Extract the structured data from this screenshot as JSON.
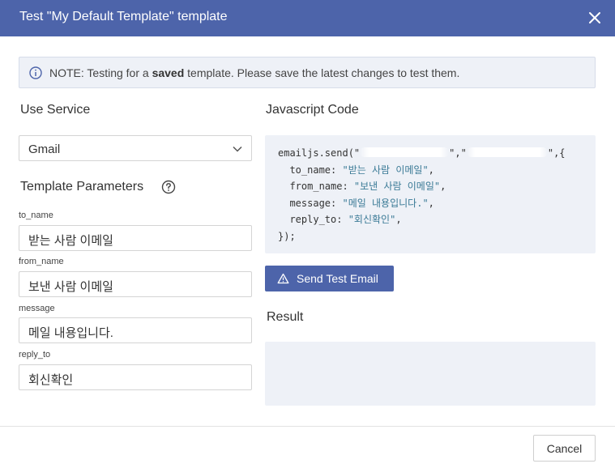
{
  "dialog": {
    "title": "Test \"My Default Template\" template",
    "close_icon": "close-icon"
  },
  "note": {
    "icon": "info-icon",
    "prefix": "NOTE: Testing for a ",
    "bold": "saved",
    "suffix": " template. Please save the latest changes to test them."
  },
  "service": {
    "heading": "Use Service",
    "selected": "Gmail"
  },
  "template_params": {
    "heading": "Template Parameters",
    "help_icon": "question-circle-icon",
    "fields": [
      {
        "label": "to_name",
        "value": "받는 사람 이메일"
      },
      {
        "label": "from_name",
        "value": "보낸 사람 이메일"
      },
      {
        "label": "message",
        "value": "메일 내용입니다."
      },
      {
        "label": "reply_to",
        "value": "회신확인"
      }
    ]
  },
  "code": {
    "heading": "Javascript Code",
    "line1_prefix": "emailjs.send(\"",
    "line1_mid": "\",\"",
    "line1_suffix": "\",{",
    "params": [
      {
        "key": "  to_name: ",
        "value": "\"받는 사람 이메일\"",
        "end": ","
      },
      {
        "key": "  from_name: ",
        "value": "\"보낸 사람 이메일\"",
        "end": ","
      },
      {
        "key": "  message: ",
        "value": "\"메일 내용입니다.\"",
        "end": ","
      },
      {
        "key": "  reply_to: ",
        "value": "\"회신확인\"",
        "end": ","
      }
    ],
    "closing": "});"
  },
  "send_button": {
    "label": "Send Test Email",
    "icon": "warning-triangle-icon"
  },
  "result": {
    "heading": "Result",
    "content": ""
  },
  "footer": {
    "cancel_label": "Cancel"
  },
  "colors": {
    "header": "#4d64aa",
    "button": "#4d64aa",
    "panel": "#eef1f7"
  }
}
